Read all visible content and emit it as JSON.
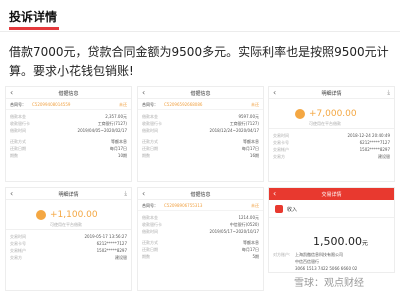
{
  "header": {
    "title": "投诉详情"
  },
  "complaint_text": "借款7000元，贷款合同金额为9500多元。实际利率也是按照9500元计算。要求小花钱包销账!",
  "screens": {
    "s1": {
      "back": "‹",
      "title": "借据信息",
      "contract_label": "合同号：",
      "contract_no": "C52099408014559",
      "status": "未还",
      "rows": [
        {
          "k": "借款本金",
          "v": "2,357.00元"
        },
        {
          "k": "收款银行卡",
          "v": "工商银行(7127)"
        },
        {
          "k": "借款时间",
          "v": "2019/04/05~2020/02/17"
        }
      ],
      "rows2": [
        {
          "k": "还款方式",
          "v": "等额本息"
        },
        {
          "k": "还款日期",
          "v": "每月17日"
        },
        {
          "k": "期数",
          "v": "10期"
        }
      ]
    },
    "s2": {
      "back": "‹",
      "title": "借据信息",
      "contract_label": "合同号：",
      "contract_no": "C52096592668086",
      "status": "未还",
      "rows": [
        {
          "k": "借款本金",
          "v": "9597.00元"
        },
        {
          "k": "收款银行卡",
          "v": "工商银行(7127)"
        },
        {
          "k": "借款时间",
          "v": "2018/12/24~2020/04/17"
        }
      ],
      "rows2": [
        {
          "k": "还款方式",
          "v": "等额本息"
        },
        {
          "k": "还款日期",
          "v": "每月17日"
        },
        {
          "k": "期数",
          "v": "16期"
        }
      ]
    },
    "s3": {
      "back": "‹",
      "title": "明细详情",
      "download": "⤓",
      "amount": "+7,000.00",
      "note": "可使用在平台借款",
      "rows": [
        {
          "k": "交易时间",
          "v": "2018-12-24 20:40:49"
        },
        {
          "k": "交易卡号",
          "v": "6212*****7127"
        },
        {
          "k": "交易帐户",
          "v": "1502*****8297"
        },
        {
          "k": "交易方",
          "v": "建设银"
        }
      ]
    },
    "s4": {
      "back": "‹",
      "title": "明细详情",
      "download": "⤓",
      "amount": "+1,100.00",
      "note": "可使用在平台借款",
      "rows": [
        {
          "k": "交易时间",
          "v": "2019-05-17 13:56:27"
        },
        {
          "k": "交易卡号",
          "v": "6212*****7127"
        },
        {
          "k": "交易帐户",
          "v": "1502*****8297"
        },
        {
          "k": "交易方",
          "v": "建设银"
        }
      ]
    },
    "s5": {
      "back": "‹",
      "title": "借据信息",
      "contract_label": "合同号：",
      "contract_no": "C52098906755313",
      "status": "未还",
      "rows": [
        {
          "k": "借款本金",
          "v": "1214.00元"
        },
        {
          "k": "收款银行卡",
          "v": "中信银行(0520)"
        },
        {
          "k": "借款时间",
          "v": "2019/05/17~2020/10/17"
        }
      ],
      "rows2": [
        {
          "k": "还款方式",
          "v": "等额本息"
        },
        {
          "k": "还款日期",
          "v": "每月17日"
        },
        {
          "k": "期数",
          "v": "5期"
        }
      ]
    },
    "s6": {
      "back": "‹",
      "title": "交易详情",
      "income_label": "收入",
      "amount": "1,500.00",
      "unit": "元",
      "rows": [
        {
          "k": "对方账户:",
          "v": "上海凯傲信息科技有限公司"
        },
        {
          "k": "",
          "v": "中信百信银行"
        },
        {
          "k": "",
          "v": "3066 1513 7422 5066 6660 02"
        }
      ]
    }
  },
  "watermark": "雪球：观点财经"
}
